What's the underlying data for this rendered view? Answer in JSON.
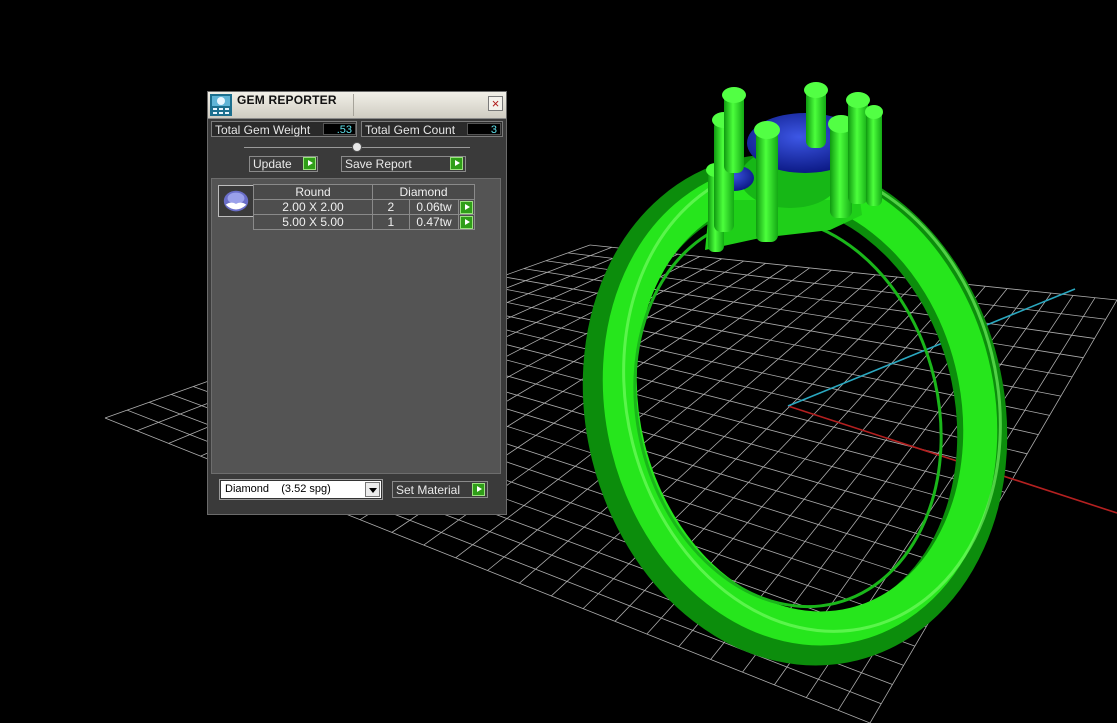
{
  "window": {
    "title": "GEM REPORTER"
  },
  "stats": {
    "total_weight_label": "Total Gem Weight",
    "total_weight_value": ".53",
    "total_count_label": "Total Gem Count",
    "total_count_value": "3"
  },
  "actions": {
    "update_label": "Update",
    "save_report_label": "Save Report",
    "set_material_label": "Set Material"
  },
  "gem_table": {
    "shape_header": "Round",
    "material_header": "Diamond",
    "rows": [
      {
        "size": "2.00 X 2.00",
        "count": "2",
        "weight": "0.06tw"
      },
      {
        "size": "5.00 X 5.00",
        "count": "1",
        "weight": "0.47tw"
      }
    ]
  },
  "material_select": {
    "selected": "Diamond    (3.52 spg)"
  },
  "colors": {
    "ring_green": "#22e01a",
    "gem_blue": "#1a2fb0",
    "grid": "#bfbfbf",
    "axis_red": "#b42020",
    "axis_cyan": "#2aa8c0",
    "panel_bg": "#3a3a3a"
  },
  "icons": {
    "app": "gem-reporter-icon",
    "close": "close-icon",
    "go": "play-arrow-icon",
    "dropdown": "chevron-down-icon"
  }
}
